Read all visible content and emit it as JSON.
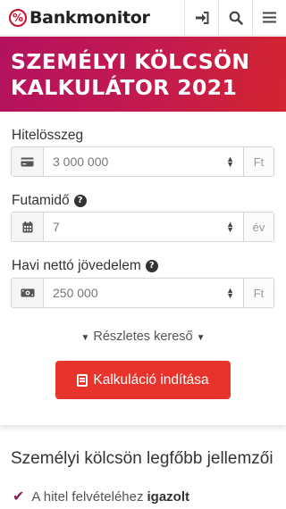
{
  "header": {
    "logo_mark": "%",
    "logo_text": "Bankmonitor",
    "icons": [
      "sign-in-icon",
      "search-icon",
      "menu-icon"
    ]
  },
  "hero": {
    "title_line1": "SZEMÉLYI KÖLCSÖN",
    "title_line2": "KALKULÁTOR 2021",
    "gradient": [
      "#b4125f",
      "#d2252f"
    ]
  },
  "form": {
    "amount": {
      "label": "Hitelösszeg",
      "value": "3 000 000",
      "unit": "Ft",
      "icon": "credit-card-icon"
    },
    "term": {
      "label": "Futamidő",
      "value": "7",
      "unit": "év",
      "icon": "calendar-icon"
    },
    "income": {
      "label": "Havi nettó jövedelem",
      "value": "250 000",
      "unit": "Ft",
      "icon": "money-icon"
    },
    "help_glyph": "?",
    "details_link": "Részletes kereső",
    "submit_label": "Kalkuláció indítása",
    "accent": "#e8332a"
  },
  "features": {
    "title": "Személyi kölcsön legfőbb jellemzői",
    "item1_text": "A hitel felvételéhez",
    "item1_bold": "igazolt"
  }
}
